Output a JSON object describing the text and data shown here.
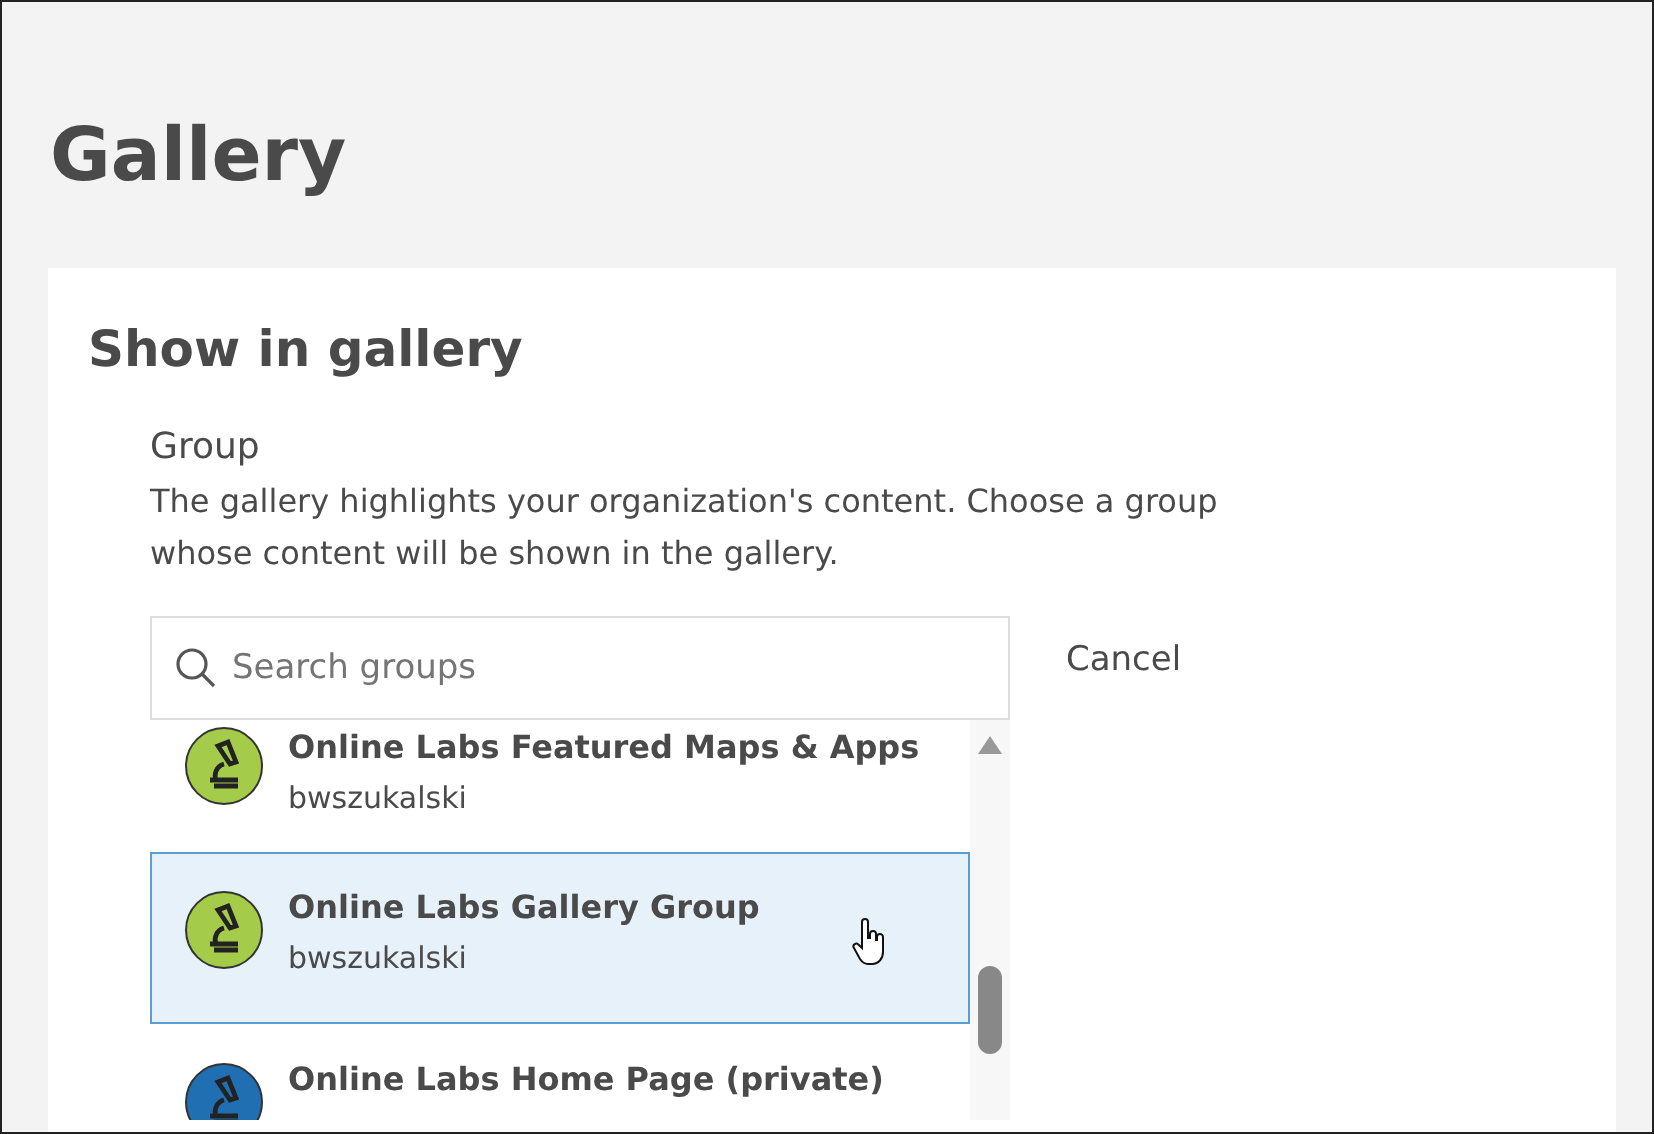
{
  "page": {
    "title": "Gallery"
  },
  "card": {
    "title": "Show in gallery",
    "field_label": "Group",
    "description": "The gallery highlights your organization's content. Choose a group whose content will be shown in the gallery.",
    "search": {
      "placeholder": "Search groups"
    },
    "cancel": "Cancel",
    "groups": [
      {
        "name": "Online Labs Featured Maps & Apps",
        "owner": "bwszukalski",
        "color": "#a4cc4a",
        "selected": false
      },
      {
        "name": "Online Labs Gallery Group",
        "owner": "bwszukalski",
        "color": "#a4cc4a",
        "selected": true
      },
      {
        "name": "Online Labs Home Page (private)",
        "color": "#1f6fb2",
        "selected": false
      }
    ]
  }
}
